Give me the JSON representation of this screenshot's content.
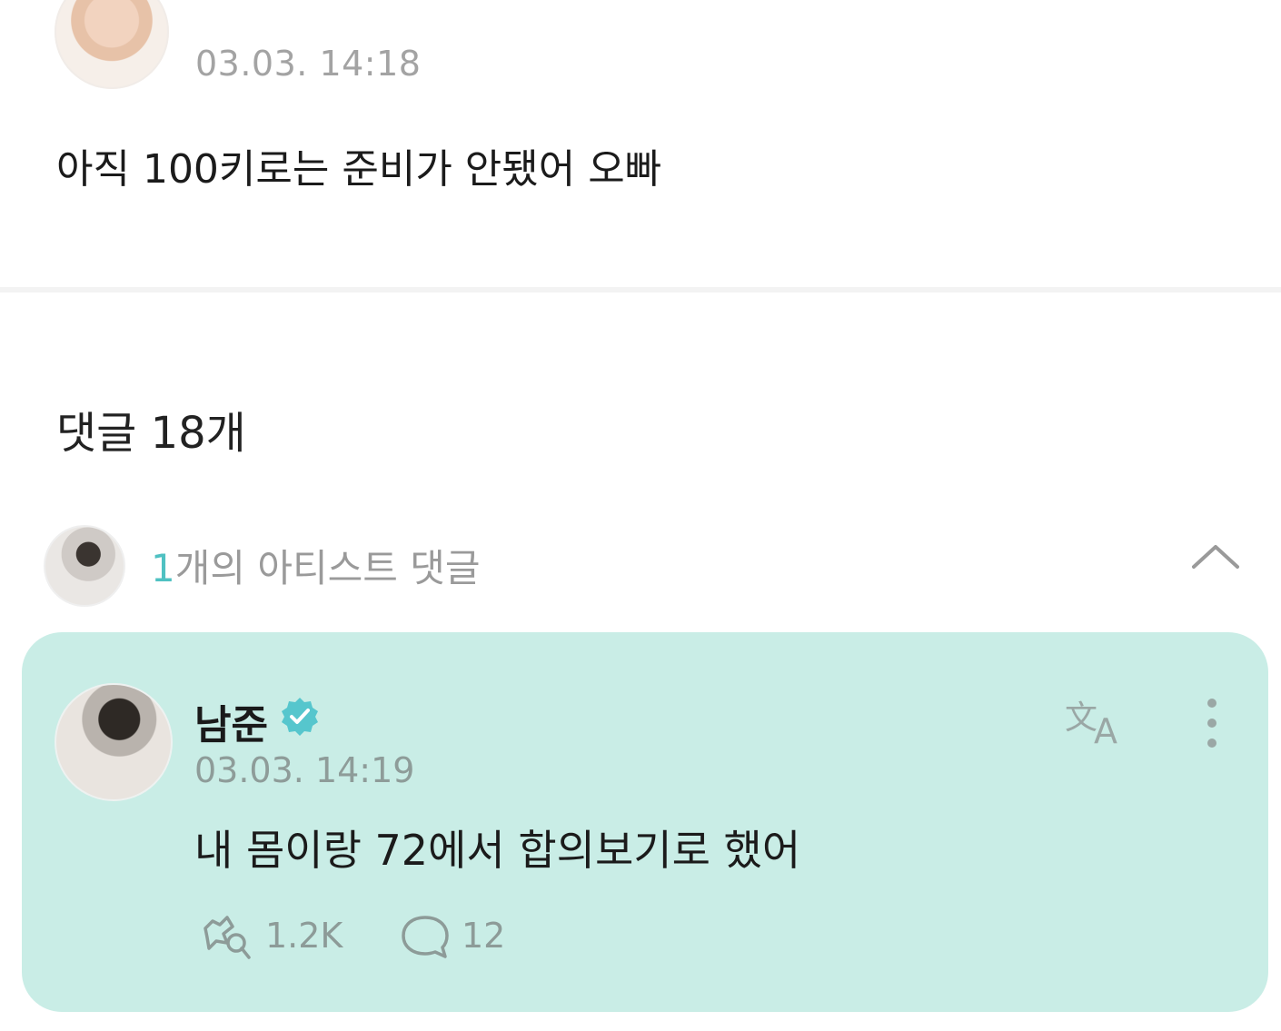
{
  "post": {
    "time": "03.03. 14:18",
    "text": "아직 100키로는 준비가 안됐어 오빠"
  },
  "comments": {
    "heading": "댓글 18개"
  },
  "artist_comments_row": {
    "count": "1",
    "label": "개의 아티스트 댓글",
    "toggle_icon": "chevron-up-icon"
  },
  "artist_comment": {
    "name": "남준",
    "verified_icon": "verified-badge-icon",
    "time": "03.03. 14:19",
    "text": "내 몸이랑 72에서 합의보기로 했어",
    "likes": "1.2K",
    "replies": "12",
    "translate_icon": "translate-icon",
    "more_icon": "more-vertical-icon",
    "like_icon": "lightstick-like-icon",
    "reply_icon": "comment-bubble-icon",
    "card_color": "#c9ede6",
    "accent_color": "#4fc1c2"
  }
}
